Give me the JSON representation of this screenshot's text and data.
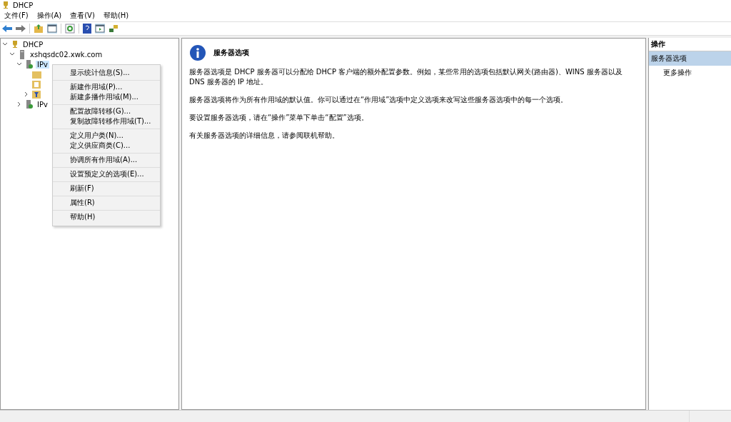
{
  "window": {
    "title": "DHCP"
  },
  "menu_bar": [
    "文件(F)",
    "操作(A)",
    "查看(V)",
    "帮助(H)"
  ],
  "tree": [
    {
      "label": "DHCP",
      "kind": "root",
      "expanded": true,
      "selected": false,
      "children": [
        {
          "label": "xshqsdc02.xwk.com",
          "kind": "server",
          "expanded": true,
          "selected": false,
          "children": [
            {
              "label": "IPv",
              "kind": "protocol",
              "expanded": true,
              "selected": true,
              "children": [
                {
                  "kind": "folder"
                },
                {
                  "kind": "document"
                },
                {
                  "kind": "filter",
                  "expanded": false
                }
              ]
            },
            {
              "label": "IPv",
              "kind": "protocol",
              "expanded": false,
              "selected": false
            }
          ]
        }
      ]
    }
  ],
  "context_menu": [
    [
      "显示统计信息(S)..."
    ],
    [
      "新建作用域(P)...",
      "新建多播作用域(M)..."
    ],
    [
      "配置故障转移(G)...",
      "复制故障转移作用域(T)..."
    ],
    [
      "定义用户类(N)...",
      "定义供应商类(C)..."
    ],
    [
      "协调所有作用域(A)..."
    ],
    [
      "设置预定义的选项(E)..."
    ],
    [
      "刷新(F)"
    ],
    [
      "属性(R)"
    ],
    [
      "帮助(H)"
    ]
  ],
  "content": {
    "title": "服务器选项",
    "paragraphs": [
      "服务器选项是 DHCP 服务器可以分配给 DHCP 客户端的额外配置参数。例如，某些常用的选项包括默认网关(路由器)、WINS 服务器以及 DNS 服务器的 IP 地址。",
      "服务器选项将作为所有作用域的默认值。你可以通过在“作用域”选项中定义选项来改写这些服务器选项中的每一个选项。",
      "要设置服务器选项，请在“操作”菜单下单击“配置”选项。",
      "有关服务器选项的详细信息，请参阅联机帮助。"
    ]
  },
  "actions": {
    "header": "操作",
    "section": "服务器选项",
    "items": [
      "更多操作"
    ]
  }
}
